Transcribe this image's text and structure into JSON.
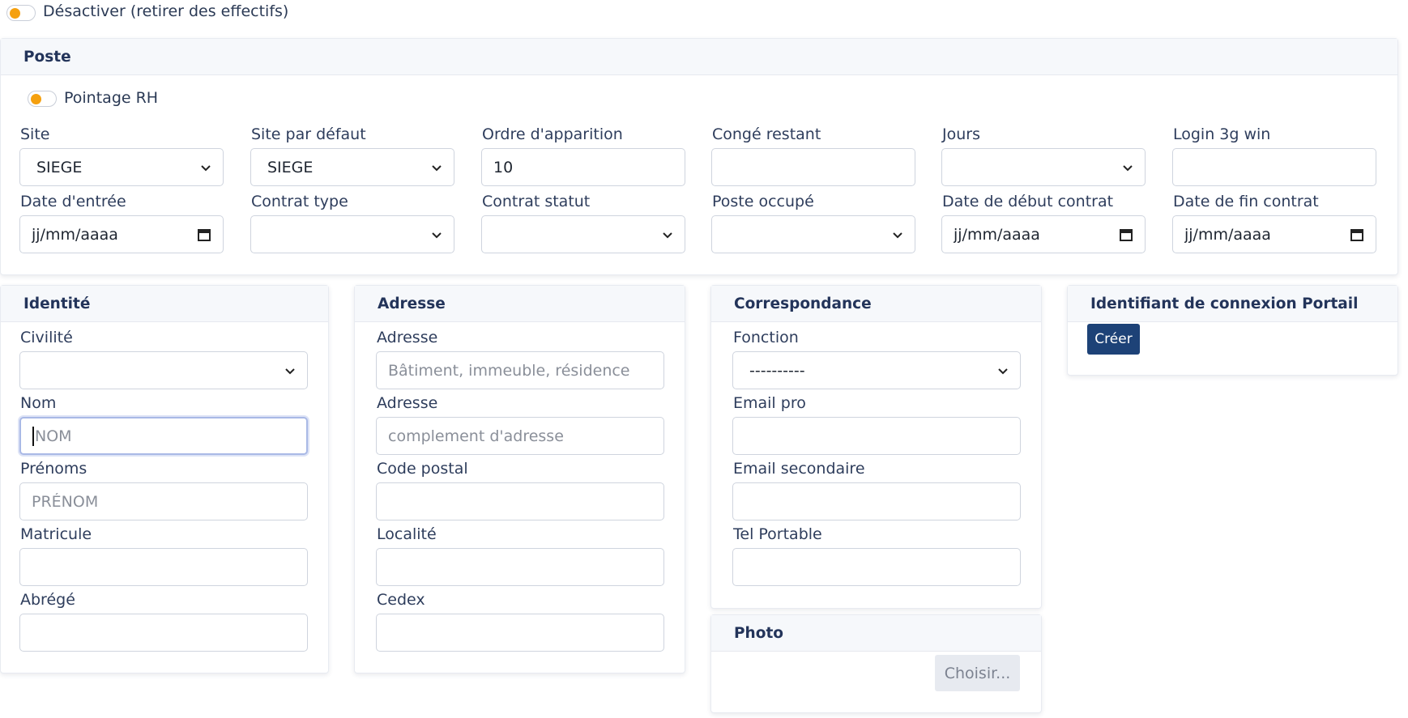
{
  "deactivate": {
    "label": "Désactiver (retirer des effectifs)",
    "checked": false
  },
  "poste": {
    "title": "Poste",
    "pointage": {
      "label": "Pointage RH",
      "checked": false
    },
    "site": {
      "label": "Site",
      "value": "SIEGE"
    },
    "site_defaut": {
      "label": "Site par défaut",
      "value": "SIEGE"
    },
    "ordre": {
      "label": "Ordre d'apparition",
      "value": "10"
    },
    "conge": {
      "label": "Congé restant",
      "value": ""
    },
    "jours": {
      "label": "Jours",
      "value": ""
    },
    "login": {
      "label": "Login 3g win",
      "value": ""
    },
    "date_entree": {
      "label": "Date d'entrée",
      "value": "jj/mm/aaaa"
    },
    "contrat_type": {
      "label": "Contrat type",
      "value": ""
    },
    "contrat_statut": {
      "label": "Contrat statut",
      "value": ""
    },
    "poste_occupe": {
      "label": "Poste occupé",
      "value": ""
    },
    "date_debut": {
      "label": "Date de début contrat",
      "value": "jj/mm/aaaa"
    },
    "date_fin": {
      "label": "Date de fin contrat",
      "value": "jj/mm/aaaa"
    }
  },
  "identite": {
    "title": "Identité",
    "civilite": {
      "label": "Civilité",
      "value": ""
    },
    "nom": {
      "label": "Nom",
      "placeholder": "NOM",
      "value": ""
    },
    "prenoms": {
      "label": "Prénoms",
      "placeholder": "PRÉNOM",
      "value": ""
    },
    "matricule": {
      "label": "Matricule",
      "value": ""
    },
    "abrege": {
      "label": "Abrégé",
      "value": ""
    }
  },
  "adresse": {
    "title": "Adresse",
    "adresse1": {
      "label": "Adresse",
      "placeholder": "Bâtiment, immeuble, résidence"
    },
    "adresse2": {
      "label": "Adresse",
      "placeholder": "complement d'adresse"
    },
    "code_postal": {
      "label": "Code postal",
      "value": ""
    },
    "localite": {
      "label": "Localité",
      "value": ""
    },
    "cedex": {
      "label": "Cedex",
      "value": ""
    }
  },
  "correspondance": {
    "title": "Correspondance",
    "fonction": {
      "label": "Fonction",
      "value": "----------"
    },
    "email_pro": {
      "label": "Email pro",
      "value": ""
    },
    "email_sec": {
      "label": "Email secondaire",
      "value": ""
    },
    "tel": {
      "label": "Tel Portable",
      "value": ""
    }
  },
  "photo": {
    "title": "Photo",
    "button": "Choisir..."
  },
  "portail": {
    "title": "Identifiant de connexion Portail",
    "button": "Créer"
  },
  "colors": {
    "accent": "#f5a00e",
    "primary": "#1d4277",
    "heading": "#23345a"
  }
}
